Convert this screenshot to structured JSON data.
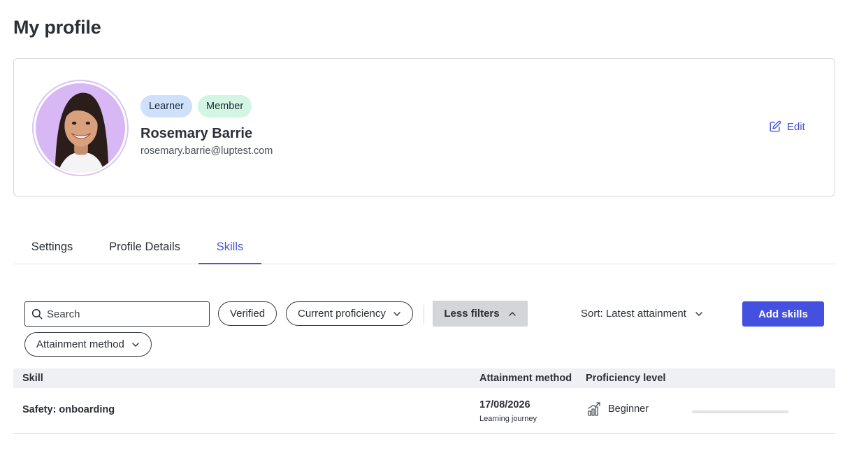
{
  "page": {
    "title": "My profile"
  },
  "profile": {
    "badges": [
      "Learner",
      "Member"
    ],
    "name": "Rosemary Barrie",
    "email": "rosemary.barrie@luptest.com",
    "edit_label": "Edit"
  },
  "tabs": [
    {
      "label": "Settings",
      "active": false
    },
    {
      "label": "Profile Details",
      "active": false
    },
    {
      "label": "Skills",
      "active": true
    }
  ],
  "filters": {
    "search_placeholder": "Search",
    "verified_label": "Verified",
    "current_proficiency_label": "Current proficiency",
    "less_filters_label": "Less filters",
    "attainment_method_label": "Attainment method",
    "sort_label": "Sort: Latest attainment",
    "add_skills_label": "Add skills"
  },
  "table": {
    "columns": [
      "Skill",
      "Attainment method",
      "Proficiency level"
    ],
    "rows": [
      {
        "skill": "Safety: onboarding",
        "date": "17/08/2026",
        "method": "Learning journey",
        "level": "Beginner",
        "progress": 0
      }
    ]
  },
  "colors": {
    "accent": "#4450e0",
    "tab_active": "#4a56d6",
    "badge_learner": "#cfe0fb",
    "badge_member": "#d3f5e3",
    "avatar_bg": "#d8b8f4"
  }
}
